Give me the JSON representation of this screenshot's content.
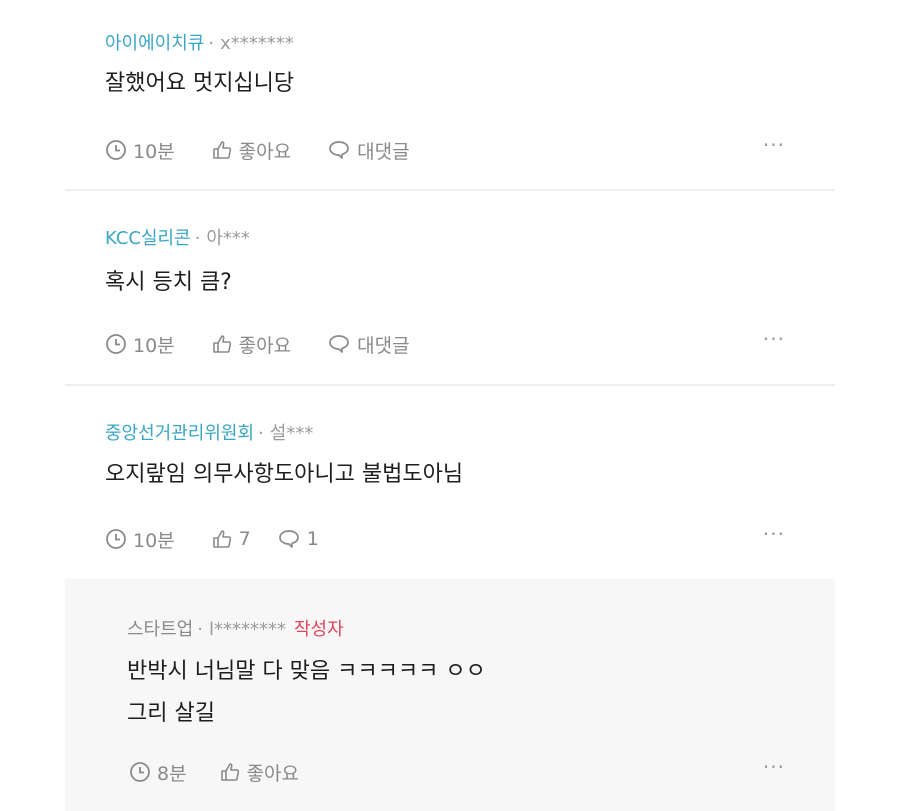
{
  "comments": [
    {
      "author": "아이에이치큐",
      "separator": "·",
      "masked_user": "x*******",
      "text": "잘했어요 멋지십니당",
      "time": "10분",
      "like_label": "좋아요",
      "reply_label": "대댓글",
      "more": "···"
    },
    {
      "author": "KCC실리콘",
      "separator": "·",
      "masked_user": "아***",
      "text": "혹시 등치 큼?",
      "time": "10분",
      "like_label": "좋아요",
      "reply_label": "대댓글",
      "more": "···"
    },
    {
      "author": "중앙선거관리위원회",
      "separator": "·",
      "masked_user": "설***",
      "text": "오지랖임 의무사항도아니고 불법도아님",
      "time": "10분",
      "like_label": "7",
      "reply_label": "1",
      "more": "···"
    }
  ],
  "reply": {
    "author": "스타트업",
    "separator": "·",
    "masked_user": "l********",
    "badge": "작성자",
    "lines": [
      "반박시 너님말 다 맞음 ㅋㅋㅋㅋㅋ ㅇㅇ",
      "그리 살길"
    ],
    "time": "8분",
    "like_label": "좋아요",
    "more": "···"
  },
  "colors": {
    "author": "#3aa6c6",
    "badge": "#e0465b",
    "meta": "#8a8a8a",
    "reply_bg": "#f7f7f7"
  },
  "icons": [
    "clock-icon",
    "thumbs-up-icon",
    "speech-bubble-icon",
    "more-icon"
  ]
}
